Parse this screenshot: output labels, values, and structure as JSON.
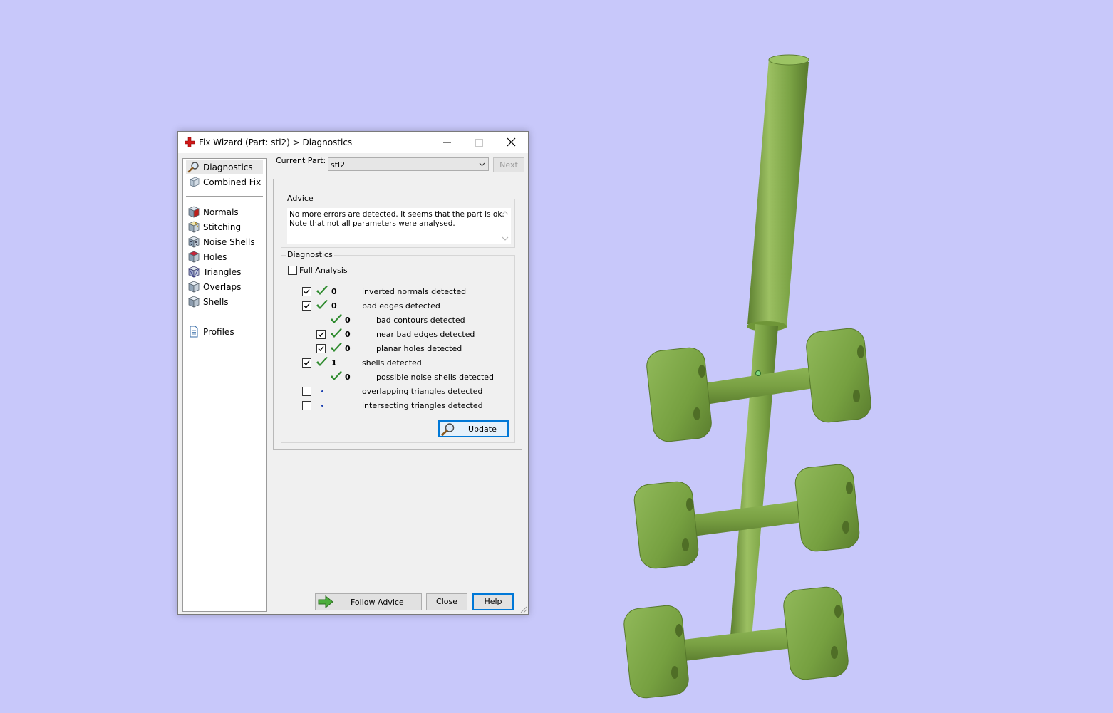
{
  "window": {
    "title": "Fix Wizard (Part: stl2) > Diagnostics",
    "icon": "red-cross-icon"
  },
  "sidebar": {
    "items": [
      {
        "label": "Diagnostics",
        "icon": "magnifier-icon",
        "active": true
      },
      {
        "label": "Combined Fix",
        "icon": "combined-fix-icon"
      },
      {
        "label": "Normals",
        "icon": "normals-cube-icon"
      },
      {
        "label": "Stitching",
        "icon": "stitching-cube-icon"
      },
      {
        "label": "Noise Shells",
        "icon": "noise-shells-icon"
      },
      {
        "label": "Holes",
        "icon": "holes-cube-icon"
      },
      {
        "label": "Triangles",
        "icon": "triangles-cube-icon"
      },
      {
        "label": "Overlaps",
        "icon": "overlaps-cube-icon"
      },
      {
        "label": "Shells",
        "icon": "shells-cube-icon"
      },
      {
        "label": "Profiles",
        "icon": "profiles-document-icon"
      }
    ]
  },
  "header": {
    "current_part_label": "Current Part:",
    "current_part_value": "stl2",
    "next_label": "Next"
  },
  "advice": {
    "title": "Advice",
    "line1": "No more errors are detected. It seems that the part is ok.",
    "line2": "Note that not all parameters were analysed."
  },
  "diagnostics": {
    "title": "Diagnostics",
    "full_analysis_label": "Full Analysis",
    "full_analysis_checked": false,
    "rows": [
      {
        "checkbox": true,
        "checked": true,
        "status": "ok",
        "count": "0",
        "label": "inverted normals detected",
        "indent": 0
      },
      {
        "checkbox": true,
        "checked": true,
        "status": "ok",
        "count": "0",
        "label": "bad edges detected",
        "indent": 0
      },
      {
        "checkbox": false,
        "checked": false,
        "status": "ok",
        "count": "0",
        "label": "bad contours detected",
        "indent": 1
      },
      {
        "checkbox": true,
        "checked": true,
        "status": "ok",
        "count": "0",
        "label": "near bad edges detected",
        "indent": 1
      },
      {
        "checkbox": true,
        "checked": true,
        "status": "ok",
        "count": "0",
        "label": "planar holes detected",
        "indent": 1
      },
      {
        "checkbox": true,
        "checked": true,
        "status": "ok",
        "count": "1",
        "label": "shells detected",
        "indent": 0
      },
      {
        "checkbox": false,
        "checked": false,
        "status": "ok",
        "count": "0",
        "label": "possible noise shells detected",
        "indent": 1
      },
      {
        "checkbox": true,
        "checked": false,
        "status": "unknown",
        "count": "",
        "label": "overlapping triangles detected",
        "indent": 0
      },
      {
        "checkbox": true,
        "checked": false,
        "status": "unknown",
        "count": "",
        "label": "intersecting triangles detected",
        "indent": 0
      }
    ],
    "update_label": "Update"
  },
  "footer": {
    "follow_advice_label": "Follow Advice",
    "close_label": "Close",
    "help_label": "Help"
  },
  "colors": {
    "background": "#c8c8fa",
    "model_green": "#7ea54a",
    "check_green": "#2e8b2e",
    "accent_blue": "#0078d7"
  }
}
